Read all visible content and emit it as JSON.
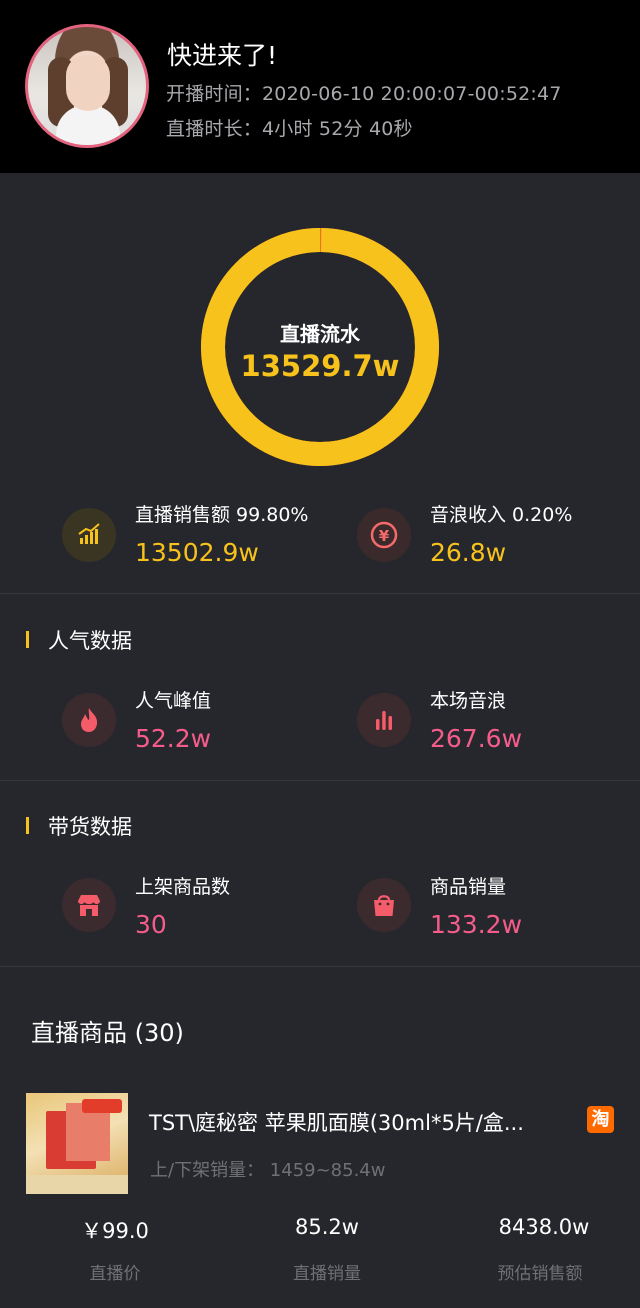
{
  "header": {
    "title": "快进来了!",
    "start_time": "开播时间：2020-06-10 20:00:07-00:52:47",
    "duration": "直播时长：4小时 52分 40秒"
  },
  "ring": {
    "label": "直播流水",
    "value": "13529.7w",
    "sales_share": 0.998,
    "sales_color": "#f7c21c",
    "wave_color": "#e8771c"
  },
  "revenue": {
    "sales_label": "直播销售额 99.80%",
    "sales_value": "13502.9w",
    "wave_label": "音浪收入 0.20%",
    "wave_value": "26.8w"
  },
  "popularity": {
    "section_title": "人气数据",
    "peak_label": "人气峰值",
    "peak_value": "52.2w",
    "wave_label": "本场音浪",
    "wave_value": "267.6w"
  },
  "goods": {
    "section_title": "带货数据",
    "listed_label": "上架商品数",
    "listed_value": "30",
    "sold_label": "商品销量",
    "sold_value": "133.2w"
  },
  "products": {
    "title": "直播商品 (30)",
    "items": [
      {
        "name": "TST\\庭秘密 苹果肌面膜(30ml*5片/盒...",
        "platform_badge": "淘",
        "sub": "上/下架销量：  1459~85.4w",
        "price": "￥99.0",
        "price_label": "直播价",
        "sales": "85.2w",
        "sales_label": "直播销量",
        "revenue": "8438.0w",
        "revenue_label": "预估销售额"
      }
    ]
  }
}
